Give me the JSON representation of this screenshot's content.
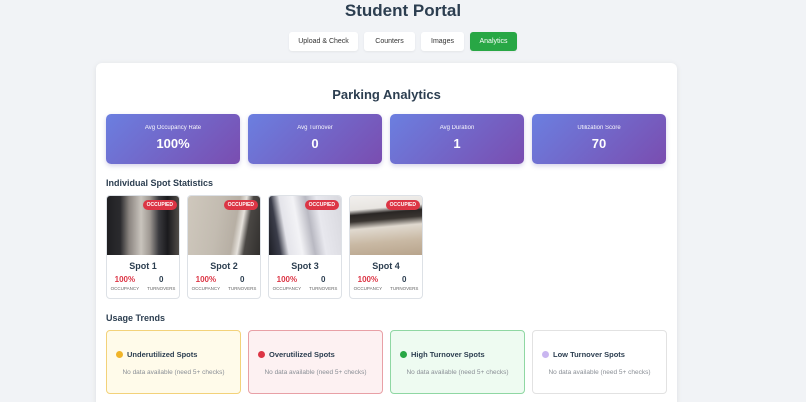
{
  "app": {
    "title": "Student Portal"
  },
  "tabs": [
    {
      "label": "Upload & Check",
      "active": false
    },
    {
      "label": "Counters",
      "active": false
    },
    {
      "label": "Images",
      "active": false
    },
    {
      "label": "Analytics",
      "active": true
    }
  ],
  "analytics": {
    "title": "Parking Analytics",
    "stats": [
      {
        "label": "Avg Occupancy Rate",
        "value": "100%"
      },
      {
        "label": "Avg Turnover",
        "value": "0"
      },
      {
        "label": "Avg Duration",
        "value": "1"
      },
      {
        "label": "Utilization Score",
        "value": "70"
      }
    ],
    "spots_title": "Individual Spot Statistics",
    "spots": [
      {
        "name": "Spot 1",
        "badge": "OCCUPIED",
        "occupancy": "100%",
        "occupancy_label": "OCCUPANCY",
        "turnovers": "0",
        "turnovers_label": "TURNOVERS"
      },
      {
        "name": "Spot 2",
        "badge": "OCCUPIED",
        "occupancy": "100%",
        "occupancy_label": "OCCUPANCY",
        "turnovers": "0",
        "turnovers_label": "TURNOVERS"
      },
      {
        "name": "Spot 3",
        "badge": "OCCUPIED",
        "occupancy": "100%",
        "occupancy_label": "OCCUPANCY",
        "turnovers": "0",
        "turnovers_label": "TURNOVERS"
      },
      {
        "name": "Spot 4",
        "badge": "OCCUPIED",
        "occupancy": "100%",
        "occupancy_label": "OCCUPANCY",
        "turnovers": "0",
        "turnovers_label": "TURNOVERS"
      }
    ],
    "trends_title": "Usage Trends",
    "trends": [
      {
        "title": "Underutilized Spots",
        "message": "No data available (need 5+ checks)",
        "dot_color": "#f0b429",
        "border": "#f3d27a",
        "background": "#fffbea"
      },
      {
        "title": "Overutilized Spots",
        "message": "No data available (need 5+ checks)",
        "dot_color": "#dc3545",
        "border": "#e8a0a6",
        "background": "#fdf1f2"
      },
      {
        "title": "High Turnover Spots",
        "message": "No data available (need 5+ checks)",
        "dot_color": "#28a745",
        "border": "#8fd7a3",
        "background": "#eefbf1"
      },
      {
        "title": "Low Turnover Spots",
        "message": "No data available (need 5+ checks)",
        "dot_color": "#c9b6f0",
        "border": "#e2e2e2",
        "background": "#ffffff"
      }
    ]
  },
  "colors": {
    "accent": "#28a745",
    "danger": "#dc3545",
    "stat_gradient_start": "#6b7fe0",
    "stat_gradient_end": "#7a4db0"
  }
}
